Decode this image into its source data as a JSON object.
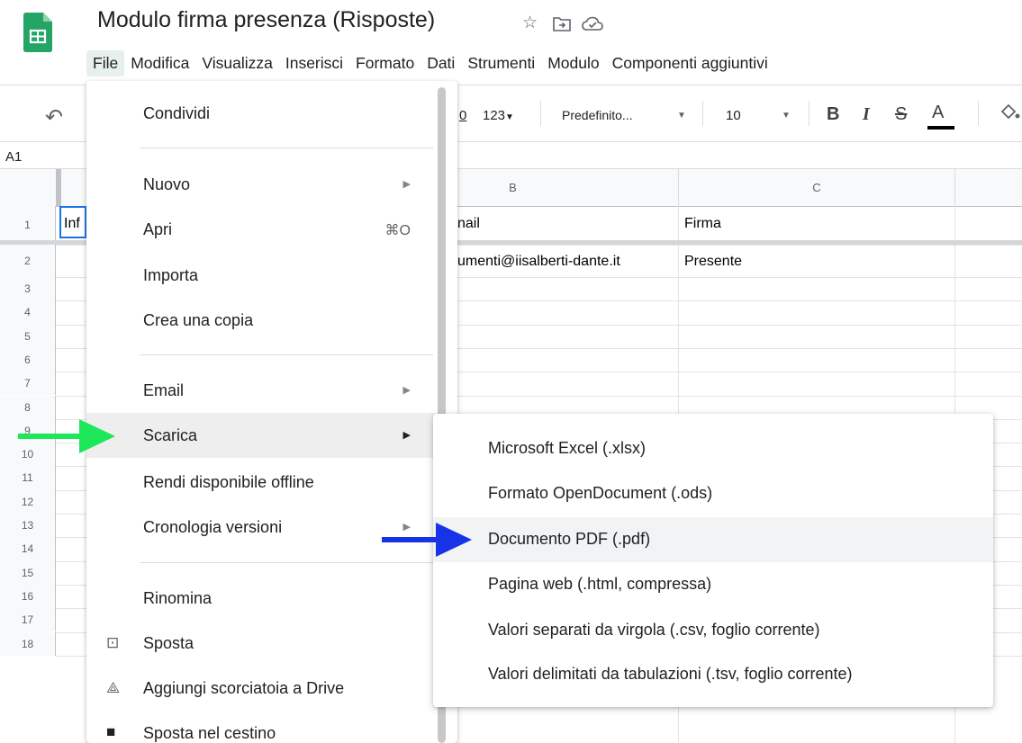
{
  "app": {
    "title": "Modulo firma presenza (Risposte)",
    "icons": [
      "sheets-logo",
      "star-icon",
      "move-folder-icon",
      "cloud-status-icon"
    ]
  },
  "menubar": [
    "File",
    "Modifica",
    "Visualizza",
    "Inserisci",
    "Formato",
    "Dati",
    "Strumenti",
    "Modulo",
    "Componenti aggiuntivi"
  ],
  "toolbar": {
    "decimal_partial": "0",
    "number_format": "123",
    "font": "Predefinito...",
    "font_size": "10",
    "bold": "B",
    "italic": "I",
    "strike": "S",
    "text_color": "A"
  },
  "namebox": "A1",
  "columns": [
    "B",
    "C"
  ],
  "rows": [
    "1",
    "2",
    "3",
    "4",
    "5",
    "6",
    "7",
    "8",
    "9",
    "10",
    "11",
    "12",
    "13",
    "14",
    "15",
    "16",
    "17",
    "18"
  ],
  "cells": {
    "a1": "Inf",
    "b1": "nail",
    "c1": "Firma",
    "b2": "umenti@iisalberti-dante.it",
    "c2": "Presente"
  },
  "file_menu": {
    "share": "Condividi",
    "new": "Nuovo",
    "open": "Apri",
    "open_shortcut": "⌘O",
    "import": "Importa",
    "copy": "Crea una copia",
    "email": "Email",
    "download": "Scarica",
    "offline": "Rendi disponibile offline",
    "history": "Cronologia versioni",
    "rename": "Rinomina",
    "move": "Sposta",
    "shortcut": "Aggiungi scorciatoia a Drive",
    "trash": "Sposta nel cestino"
  },
  "download_menu": [
    "Microsoft Excel (.xlsx)",
    "Formato OpenDocument (.ods)",
    "Documento PDF (.pdf)",
    "Pagina web (.html, compressa)",
    "Valori separati da virgola (.csv, foglio corrente)",
    "Valori delimitati da tabulazioni (.tsv, foglio corrente)"
  ],
  "colors": {
    "sheets_green": "#23a566",
    "arrow_green": "#1ee85a",
    "arrow_blue": "#1733e8"
  }
}
